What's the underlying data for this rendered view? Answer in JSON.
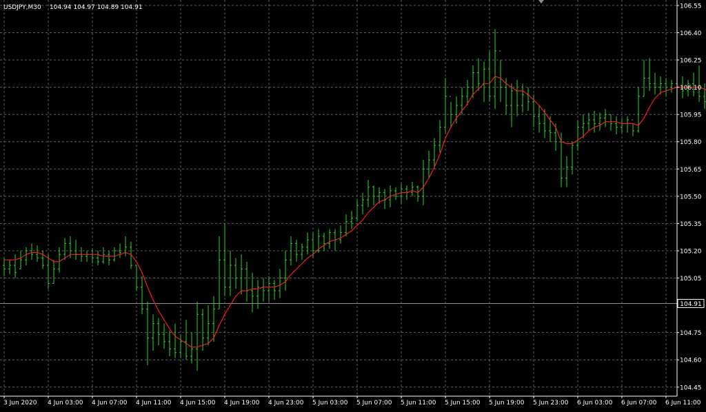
{
  "chart_data": {
    "type": "ohlc",
    "title": "USDJPY,M30",
    "ohlc_readout": "104.94 104.97 104.89 104.91",
    "current_price": 104.91,
    "current_price_label": "104.91",
    "ylim": [
      104.4,
      106.58
    ],
    "yticks": [
      "106.55",
      "106.40",
      "106.25",
      "106.10",
      "105.95",
      "105.80",
      "105.65",
      "105.50",
      "105.35",
      "105.20",
      "105.05",
      "104.75",
      "104.60",
      "104.45"
    ],
    "xticks": [
      "3 Jun 2020",
      "4 Jun 03:00",
      "4 Jun 07:00",
      "4 Jun 11:00",
      "4 Jun 15:00",
      "4 Jun 19:00",
      "4 Jun 23:00",
      "5 Jun 03:00",
      "5 Jun 07:00",
      "5 Jun 11:00",
      "5 Jun 15:00",
      "5 Jun 19:00",
      "5 Jun 23:00",
      "6 Jun 03:00",
      "6 Jun 07:00",
      "6 Jun 11:00"
    ],
    "xtick_index": [
      0,
      8,
      16,
      24,
      32,
      40,
      48,
      56,
      64,
      72,
      80,
      88,
      96,
      104,
      112,
      120
    ],
    "grid": true,
    "colors": {
      "bars": "#22dd22",
      "moving_average": "#ff1a1a",
      "background": "#000000",
      "grid": "#5a6066"
    },
    "bars": [
      {
        "h": 105.16,
        "l": 105.06,
        "o": 105.12,
        "c": 105.1
      },
      {
        "h": 105.15,
        "l": 105.07,
        "o": 105.1,
        "c": 105.12
      },
      {
        "h": 105.18,
        "l": 105.05,
        "o": 105.12,
        "c": 105.08
      },
      {
        "h": 105.2,
        "l": 105.1,
        "o": 105.1,
        "c": 105.15
      },
      {
        "h": 105.22,
        "l": 105.12,
        "o": 105.15,
        "c": 105.2
      },
      {
        "h": 105.24,
        "l": 105.15,
        "o": 105.2,
        "c": 105.18
      },
      {
        "h": 105.23,
        "l": 105.14,
        "o": 105.18,
        "c": 105.16
      },
      {
        "h": 105.2,
        "l": 105.1,
        "o": 105.16,
        "c": 105.12
      },
      {
        "h": 105.18,
        "l": 104.99,
        "o": 105.12,
        "c": 105.02
      },
      {
        "h": 105.15,
        "l": 105.02,
        "o": 105.02,
        "c": 105.1
      },
      {
        "h": 105.22,
        "l": 105.08,
        "o": 105.1,
        "c": 105.18
      },
      {
        "h": 105.27,
        "l": 105.15,
        "o": 105.18,
        "c": 105.24
      },
      {
        "h": 105.28,
        "l": 105.16,
        "o": 105.24,
        "c": 105.2
      },
      {
        "h": 105.26,
        "l": 105.15,
        "o": 105.2,
        "c": 105.18
      },
      {
        "h": 105.22,
        "l": 105.14,
        "o": 105.18,
        "c": 105.17
      },
      {
        "h": 105.2,
        "l": 105.14,
        "o": 105.17,
        "c": 105.18
      },
      {
        "h": 105.21,
        "l": 105.13,
        "o": 105.18,
        "c": 105.16
      },
      {
        "h": 105.2,
        "l": 105.12,
        "o": 105.16,
        "c": 105.14
      },
      {
        "h": 105.22,
        "l": 105.13,
        "o": 105.14,
        "c": 105.18
      },
      {
        "h": 105.2,
        "l": 105.12,
        "o": 105.18,
        "c": 105.15
      },
      {
        "h": 105.22,
        "l": 105.14,
        "o": 105.15,
        "c": 105.2
      },
      {
        "h": 105.24,
        "l": 105.16,
        "o": 105.2,
        "c": 105.19
      },
      {
        "h": 105.28,
        "l": 105.17,
        "o": 105.19,
        "c": 105.22
      },
      {
        "h": 105.25,
        "l": 105.1,
        "o": 105.22,
        "c": 105.12
      },
      {
        "h": 105.12,
        "l": 104.98,
        "o": 105.12,
        "c": 105.0
      },
      {
        "h": 105.06,
        "l": 104.85,
        "o": 105.0,
        "c": 104.88
      },
      {
        "h": 104.92,
        "l": 104.57,
        "o": 104.88,
        "c": 104.72
      },
      {
        "h": 104.85,
        "l": 104.65,
        "o": 104.72,
        "c": 104.8
      },
      {
        "h": 104.83,
        "l": 104.68,
        "o": 104.8,
        "c": 104.74
      },
      {
        "h": 104.8,
        "l": 104.66,
        "o": 104.74,
        "c": 104.7
      },
      {
        "h": 104.76,
        "l": 104.62,
        "o": 104.7,
        "c": 104.66
      },
      {
        "h": 104.8,
        "l": 104.61,
        "o": 104.66,
        "c": 104.64
      },
      {
        "h": 104.74,
        "l": 104.61,
        "o": 104.64,
        "c": 104.7
      },
      {
        "h": 104.82,
        "l": 104.6,
        "o": 104.7,
        "c": 104.62
      },
      {
        "h": 104.75,
        "l": 104.58,
        "o": 104.62,
        "c": 104.66
      },
      {
        "h": 104.92,
        "l": 104.54,
        "o": 104.66,
        "c": 104.85
      },
      {
        "h": 104.88,
        "l": 104.65,
        "o": 104.85,
        "c": 104.72
      },
      {
        "h": 104.9,
        "l": 104.68,
        "o": 104.72,
        "c": 104.8
      },
      {
        "h": 104.95,
        "l": 104.7,
        "o": 104.8,
        "c": 104.88
      },
      {
        "h": 105.28,
        "l": 104.88,
        "o": 104.88,
        "c": 105.15
      },
      {
        "h": 105.35,
        "l": 104.95,
        "o": 105.15,
        "c": 105.0
      },
      {
        "h": 105.2,
        "l": 104.95,
        "o": 105.0,
        "c": 105.12
      },
      {
        "h": 105.16,
        "l": 104.99,
        "o": 105.12,
        "c": 105.05
      },
      {
        "h": 105.18,
        "l": 104.96,
        "o": 105.05,
        "c": 105.1
      },
      {
        "h": 105.14,
        "l": 104.92,
        "o": 105.1,
        "c": 104.98
      },
      {
        "h": 105.08,
        "l": 104.86,
        "o": 104.98,
        "c": 104.95
      },
      {
        "h": 105.04,
        "l": 104.88,
        "o": 104.95,
        "c": 105.0
      },
      {
        "h": 105.05,
        "l": 104.92,
        "o": 105.0,
        "c": 104.98
      },
      {
        "h": 105.06,
        "l": 104.92,
        "o": 104.98,
        "c": 105.02
      },
      {
        "h": 105.04,
        "l": 104.93,
        "o": 105.02,
        "c": 104.98
      },
      {
        "h": 105.1,
        "l": 104.94,
        "o": 104.98,
        "c": 105.05
      },
      {
        "h": 105.2,
        "l": 104.98,
        "o": 105.05,
        "c": 105.15
      },
      {
        "h": 105.28,
        "l": 105.12,
        "o": 105.15,
        "c": 105.24
      },
      {
        "h": 105.26,
        "l": 105.14,
        "o": 105.24,
        "c": 105.18
      },
      {
        "h": 105.24,
        "l": 105.15,
        "o": 105.18,
        "c": 105.22
      },
      {
        "h": 105.3,
        "l": 105.18,
        "o": 105.22,
        "c": 105.26
      },
      {
        "h": 105.3,
        "l": 105.16,
        "o": 105.26,
        "c": 105.2
      },
      {
        "h": 105.32,
        "l": 105.19,
        "o": 105.2,
        "c": 105.28
      },
      {
        "h": 105.3,
        "l": 105.2,
        "o": 105.28,
        "c": 105.24
      },
      {
        "h": 105.32,
        "l": 105.21,
        "o": 105.24,
        "c": 105.3
      },
      {
        "h": 105.32,
        "l": 105.2,
        "o": 105.3,
        "c": 105.26
      },
      {
        "h": 105.34,
        "l": 105.24,
        "o": 105.26,
        "c": 105.3
      },
      {
        "h": 105.4,
        "l": 105.28,
        "o": 105.3,
        "c": 105.36
      },
      {
        "h": 105.42,
        "l": 105.32,
        "o": 105.36,
        "c": 105.38
      },
      {
        "h": 105.48,
        "l": 105.36,
        "o": 105.38,
        "c": 105.45
      },
      {
        "h": 105.52,
        "l": 105.4,
        "o": 105.45,
        "c": 105.48
      },
      {
        "h": 105.59,
        "l": 105.44,
        "o": 105.48,
        "c": 105.55
      },
      {
        "h": 105.56,
        "l": 105.45,
        "o": 105.55,
        "c": 105.5
      },
      {
        "h": 105.55,
        "l": 105.46,
        "o": 105.5,
        "c": 105.52
      },
      {
        "h": 105.54,
        "l": 105.43,
        "o": 105.52,
        "c": 105.48
      },
      {
        "h": 105.56,
        "l": 105.44,
        "o": 105.48,
        "c": 105.53
      },
      {
        "h": 105.55,
        "l": 105.48,
        "o": 105.53,
        "c": 105.5
      },
      {
        "h": 105.57,
        "l": 105.46,
        "o": 105.5,
        "c": 105.54
      },
      {
        "h": 105.56,
        "l": 105.48,
        "o": 105.54,
        "c": 105.52
      },
      {
        "h": 105.58,
        "l": 105.5,
        "o": 105.52,
        "c": 105.55
      },
      {
        "h": 105.56,
        "l": 105.47,
        "o": 105.55,
        "c": 105.5
      },
      {
        "h": 105.7,
        "l": 105.45,
        "o": 105.5,
        "c": 105.65
      },
      {
        "h": 105.75,
        "l": 105.6,
        "o": 105.65,
        "c": 105.7
      },
      {
        "h": 105.82,
        "l": 105.65,
        "o": 105.7,
        "c": 105.78
      },
      {
        "h": 105.92,
        "l": 105.74,
        "o": 105.78,
        "c": 105.88
      },
      {
        "h": 106.15,
        "l": 105.85,
        "o": 105.88,
        "c": 106.05
      },
      {
        "h": 106.02,
        "l": 105.88,
        "o": 106.05,
        "c": 105.95
      },
      {
        "h": 106.05,
        "l": 105.9,
        "o": 105.95,
        "c": 106.0
      },
      {
        "h": 106.1,
        "l": 105.95,
        "o": 106.0,
        "c": 106.05
      },
      {
        "h": 106.14,
        "l": 106.0,
        "o": 106.05,
        "c": 106.1
      },
      {
        "h": 106.22,
        "l": 106.04,
        "o": 106.1,
        "c": 106.18
      },
      {
        "h": 106.26,
        "l": 106.08,
        "o": 106.18,
        "c": 106.12
      },
      {
        "h": 106.24,
        "l": 106.02,
        "o": 106.12,
        "c": 106.2
      },
      {
        "h": 106.3,
        "l": 106.02,
        "o": 106.2,
        "c": 106.05
      },
      {
        "h": 106.42,
        "l": 105.98,
        "o": 106.05,
        "c": 106.3
      },
      {
        "h": 106.25,
        "l": 106.02,
        "o": 106.3,
        "c": 106.1
      },
      {
        "h": 106.15,
        "l": 105.95,
        "o": 106.1,
        "c": 106.0
      },
      {
        "h": 106.12,
        "l": 105.88,
        "o": 106.0,
        "c": 106.08
      },
      {
        "h": 106.14,
        "l": 105.94,
        "o": 106.08,
        "c": 106.0
      },
      {
        "h": 106.12,
        "l": 105.96,
        "o": 106.0,
        "c": 106.06
      },
      {
        "h": 106.1,
        "l": 105.97,
        "o": 106.06,
        "c": 106.02
      },
      {
        "h": 106.06,
        "l": 105.88,
        "o": 106.02,
        "c": 105.94
      },
      {
        "h": 106.0,
        "l": 105.85,
        "o": 105.94,
        "c": 105.9
      },
      {
        "h": 105.98,
        "l": 105.82,
        "o": 105.9,
        "c": 105.86
      },
      {
        "h": 105.94,
        "l": 105.8,
        "o": 105.86,
        "c": 105.85
      },
      {
        "h": 105.9,
        "l": 105.75,
        "o": 105.85,
        "c": 105.8
      },
      {
        "h": 105.85,
        "l": 105.55,
        "o": 105.8,
        "c": 105.6
      },
      {
        "h": 105.72,
        "l": 105.55,
        "o": 105.6,
        "c": 105.66
      },
      {
        "h": 105.8,
        "l": 105.62,
        "o": 105.66,
        "c": 105.78
      },
      {
        "h": 105.92,
        "l": 105.75,
        "o": 105.78,
        "c": 105.88
      },
      {
        "h": 105.95,
        "l": 105.82,
        "o": 105.88,
        "c": 105.9
      },
      {
        "h": 105.96,
        "l": 105.86,
        "o": 105.9,
        "c": 105.92
      },
      {
        "h": 105.97,
        "l": 105.85,
        "o": 105.92,
        "c": 105.9
      },
      {
        "h": 105.96,
        "l": 105.86,
        "o": 105.9,
        "c": 105.93
      },
      {
        "h": 105.98,
        "l": 105.88,
        "o": 105.93,
        "c": 105.95
      },
      {
        "h": 105.95,
        "l": 105.86,
        "o": 105.95,
        "c": 105.9
      },
      {
        "h": 105.94,
        "l": 105.84,
        "o": 105.9,
        "c": 105.88
      },
      {
        "h": 105.93,
        "l": 105.85,
        "o": 105.88,
        "c": 105.9
      },
      {
        "h": 105.94,
        "l": 105.85,
        "o": 105.9,
        "c": 105.92
      },
      {
        "h": 105.9,
        "l": 105.83,
        "o": 105.92,
        "c": 105.86
      },
      {
        "h": 106.1,
        "l": 105.85,
        "o": 105.86,
        "c": 106.05
      },
      {
        "h": 106.25,
        "l": 106.05,
        "o": 106.05,
        "c": 106.15
      },
      {
        "h": 106.26,
        "l": 106.08,
        "o": 106.15,
        "c": 106.12
      },
      {
        "h": 106.18,
        "l": 106.06,
        "o": 106.12,
        "c": 106.1
      },
      {
        "h": 106.16,
        "l": 106.06,
        "o": 106.1,
        "c": 106.12
      },
      {
        "h": 106.15,
        "l": 106.05,
        "o": 106.12,
        "c": 106.1
      },
      {
        "h": 106.14,
        "l": 106.07,
        "o": 106.1,
        "c": 106.12
      },
      {
        "h": 106.18,
        "l": 106.06,
        "o": 106.12,
        "c": 106.1
      },
      {
        "h": 106.16,
        "l": 106.04,
        "o": 106.1,
        "c": 106.08
      },
      {
        "h": 106.14,
        "l": 106.05,
        "o": 106.08,
        "c": 106.12
      },
      {
        "h": 106.18,
        "l": 106.05,
        "o": 106.12,
        "c": 106.1
      },
      {
        "h": 106.22,
        "l": 106.02,
        "o": 106.1,
        "c": 106.05
      },
      {
        "h": 106.12,
        "l": 105.98,
        "o": 106.05,
        "c": 106.02
      },
      {
        "h": 106.1,
        "l": 105.93,
        "o": 106.02,
        "c": 106.05
      },
      {
        "h": 106.1,
        "l": 105.98,
        "o": 106.05,
        "c": 106.02
      },
      {
        "h": 106.08,
        "l": 105.97,
        "o": 106.02,
        "c": 106.04
      },
      {
        "h": 106.08,
        "l": 105.98,
        "o": 106.04,
        "c": 106.06
      },
      {
        "h": 106.18,
        "l": 106.02,
        "o": 106.06,
        "c": 106.12
      }
    ],
    "moving_average": [
      105.15,
      105.15,
      105.15,
      105.16,
      105.18,
      105.19,
      105.19,
      105.18,
      105.16,
      105.14,
      105.14,
      105.16,
      105.18,
      105.18,
      105.18,
      105.18,
      105.18,
      105.18,
      105.17,
      105.17,
      105.17,
      105.18,
      105.19,
      105.18,
      105.14,
      105.08,
      105.0,
      104.93,
      104.87,
      104.82,
      104.77,
      104.73,
      104.71,
      104.69,
      104.67,
      104.67,
      104.68,
      104.69,
      104.72,
      104.79,
      104.85,
      104.9,
      104.95,
      104.98,
      104.98,
      104.99,
      104.99,
      105.0,
      105.0,
      105.0,
      105.01,
      105.03,
      105.07,
      105.1,
      105.13,
      105.16,
      105.18,
      105.21,
      105.23,
      105.25,
      105.26,
      105.27,
      105.29,
      105.31,
      105.34,
      105.37,
      105.41,
      105.44,
      105.47,
      105.48,
      105.5,
      105.51,
      105.52,
      105.52,
      105.53,
      105.52,
      105.55,
      105.6,
      105.66,
      105.73,
      105.82,
      105.88,
      105.93,
      105.97,
      106.01,
      106.06,
      106.09,
      106.12,
      106.12,
      106.16,
      106.15,
      106.12,
      106.1,
      106.08,
      106.08,
      106.06,
      106.03,
      106.0,
      105.96,
      105.92,
      105.88,
      105.8,
      105.79,
      105.79,
      105.81,
      105.83,
      105.86,
      105.88,
      105.89,
      105.91,
      105.91,
      105.91,
      105.9,
      105.9,
      105.9,
      105.89,
      105.93,
      105.99,
      106.04,
      106.07,
      106.08,
      106.09,
      106.1,
      106.1,
      106.1,
      106.1,
      106.1,
      106.09,
      106.07,
      106.06,
      106.05,
      106.04,
      106.04,
      106.05,
      106.07
    ]
  }
}
